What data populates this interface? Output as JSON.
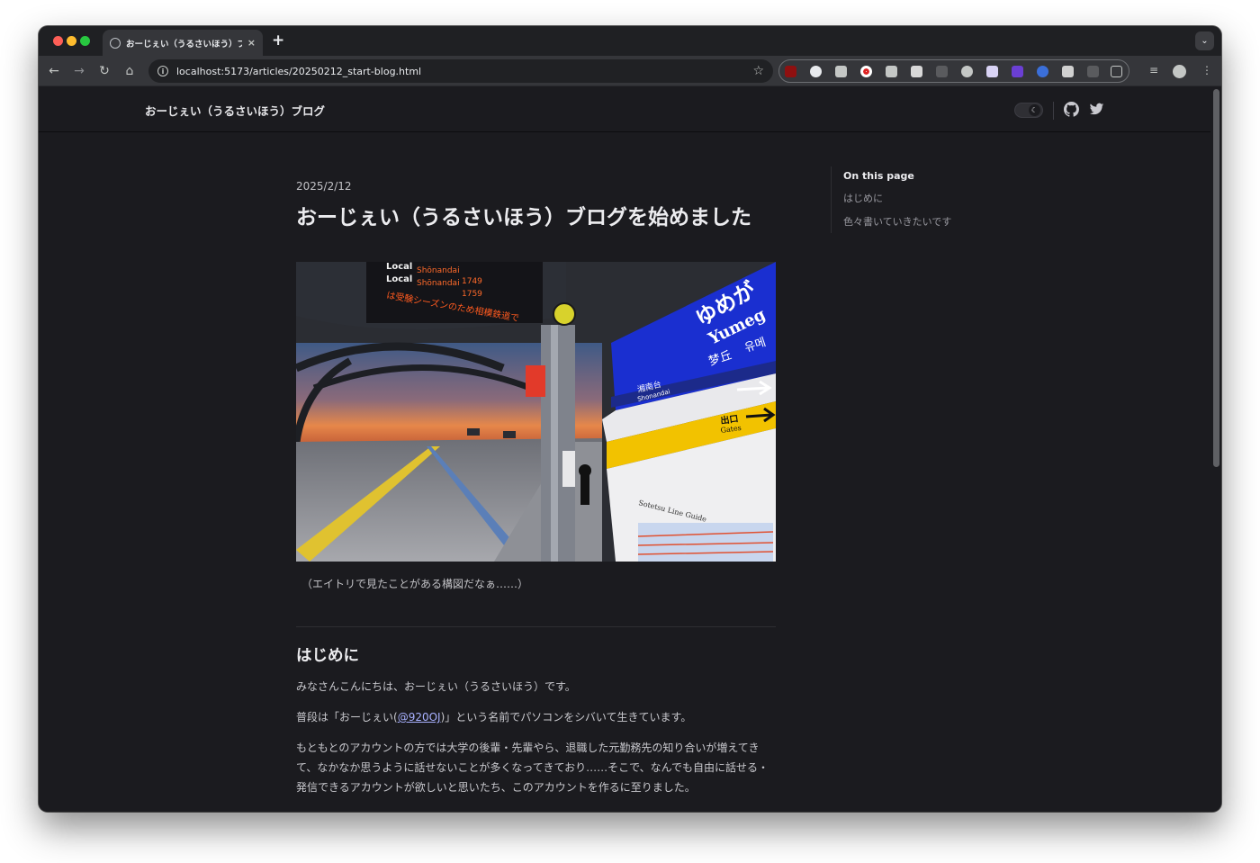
{
  "browser": {
    "tab_title": "おーじぇい（うるさいほう）ブロ",
    "url": "localhost:5173/articles/20250212_start-blog.html",
    "new_tab_label": "+",
    "tab_close_label": "×"
  },
  "site": {
    "brand": "おーじぇい（うるさいほう）ブログ"
  },
  "article": {
    "date": "2025/2/12",
    "title": "おーじぇい（うるさいほう）ブログを始めました",
    "image": {
      "sign_station_hiragana": "ゆめが",
      "sign_station_romaji": "Yumeg",
      "sign_kanji": "梦丘",
      "sign_hangul": "유메",
      "sign_next": "湘南台",
      "sign_next_romaji": "Shonandai",
      "sign_exit": "出口",
      "sign_gates": "Gates",
      "sign_guide": "Sotetsu Line Guide",
      "board_line1_type": "Local",
      "board_line1_dest": "Shōnandai",
      "board_line1_time": "1749",
      "board_line2_type": "Local",
      "board_line2_dest": "Shōnandai",
      "board_line2_time": "1759",
      "board_scroll": "は受験シーズンのため相模鉄道で"
    },
    "caption": "（エイトリで見たことがある構図だなぁ……）",
    "section1": {
      "heading": "はじめに",
      "p1": "みなさんこんにちは、おーじぇい（うるさいほう）です。",
      "p2_before": "普段は「おーじぇい(",
      "p2_link": "@920OJ",
      "p2_after": ")」という名前でパソコンをシバいて生きています。",
      "p3": "もともとのアカウントの方では大学の後輩・先輩やら、退職した元勤務先の知り合いが増えてきて、なかなか思うように話せないことが多くなってきており……そこで、なんでも自由に話せる・発信できるアカウントが欲しいと思いたち、このアカウントを作るに至りました。"
    }
  },
  "toc": {
    "title": "On this page",
    "items": [
      "はじめに",
      "色々書いていきたいです"
    ]
  },
  "colors": {
    "page_bg": "#1b1b1f",
    "accent_link": "#a8b1ff",
    "sign_blue": "#1a2fd0",
    "sign_yellow": "#f2c200"
  },
  "icons": [
    "back-icon",
    "forward-icon",
    "reload-icon",
    "home-icon",
    "info-icon",
    "star-icon",
    "extensions-icon",
    "menu-icon",
    "github-icon",
    "twitter-icon",
    "moon-icon"
  ]
}
